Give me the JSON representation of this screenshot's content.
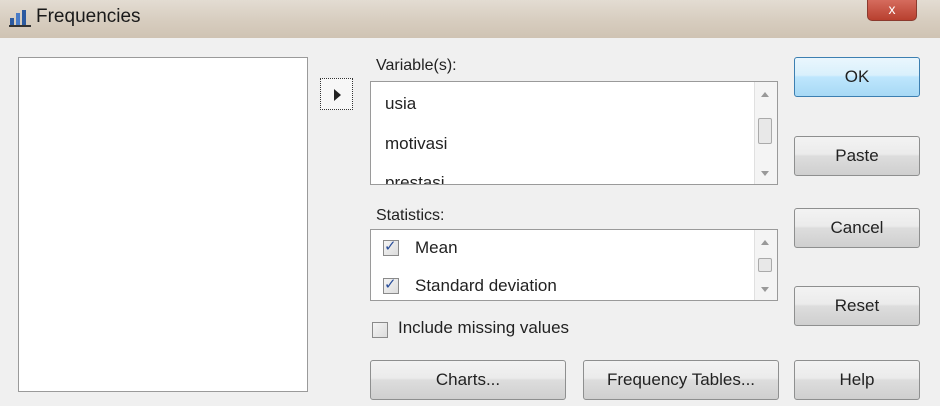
{
  "window": {
    "title": "Frequencies",
    "close_glyph": "x"
  },
  "variables": {
    "label": "Variable(s):",
    "items": [
      "usia",
      "motivasi",
      "prestasi"
    ]
  },
  "statistics": {
    "label": "Statistics:",
    "items": [
      {
        "label": "Mean",
        "checked": true
      },
      {
        "label": "Standard deviation",
        "checked": true
      }
    ]
  },
  "missing_values": {
    "label": "Include missing values",
    "checked": false
  },
  "buttons": {
    "ok": "OK",
    "paste": "Paste",
    "cancel": "Cancel",
    "reset": "Reset",
    "help": "Help",
    "charts": "Charts...",
    "frequency_tables": "Frequency Tables..."
  }
}
